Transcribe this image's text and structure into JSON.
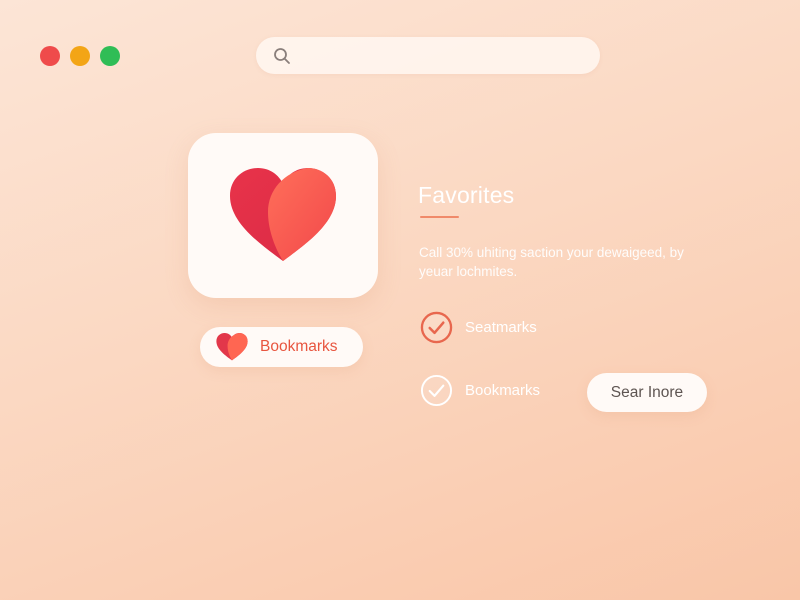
{
  "window_controls": {
    "close_color": "#ef4b4b",
    "minimize_color": "#f3a516",
    "maximize_color": "#30bd56"
  },
  "search": {
    "placeholder": "",
    "value": "",
    "icon": "search-icon"
  },
  "app_tile": {
    "icon": "heart-icon",
    "colors": [
      "#e6394b",
      "#ff6a52"
    ]
  },
  "bookmarks_pill": {
    "label": "Bookmarks",
    "icon": "heart-icon"
  },
  "section": {
    "title": "Favorites",
    "description": "Call 30% uhiting saction your dewaigeed, by yeuar lochmites.",
    "accent_color": "#f08a6a"
  },
  "check_items": [
    {
      "label": "Seatmarks",
      "checked": true,
      "icon": "check-circle-icon"
    },
    {
      "label": "Bookmarks",
      "checked": true,
      "icon": "check-circle-icon"
    }
  ],
  "see_more_button": {
    "label": "Sear Inore"
  }
}
